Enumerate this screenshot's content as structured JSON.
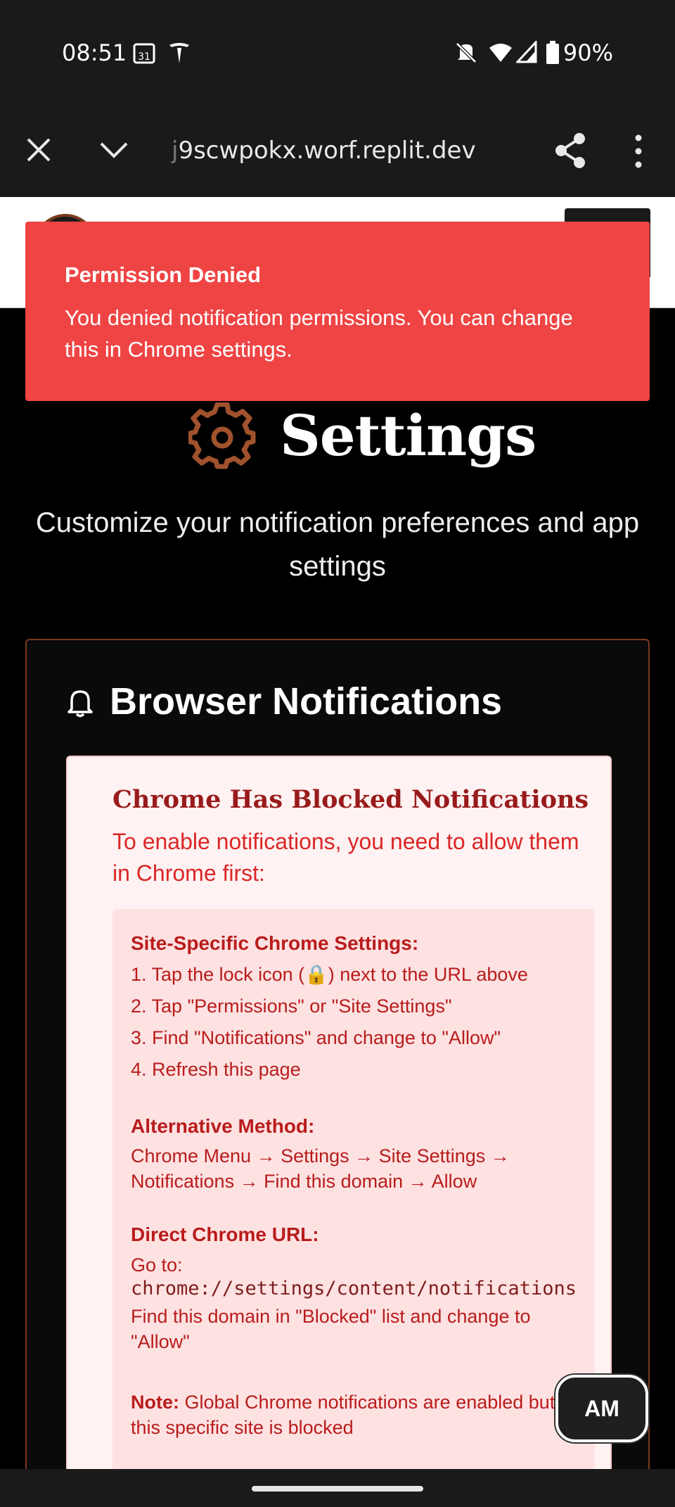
{
  "status_bar": {
    "time": "08:51",
    "battery": "90%",
    "icons": [
      "calendar-icon",
      "tesla-icon",
      "mute-icon",
      "wifi-icon",
      "signal-icon",
      "battery-icon"
    ]
  },
  "browser": {
    "url_prefix": "j",
    "url": "9scwpokx.worf.replit.dev"
  },
  "toast": {
    "title": "Permission Denied",
    "description": "You denied notification permissions. You can change this in Chrome settings.",
    "color": "#ef4444"
  },
  "page": {
    "title": "Settings",
    "subtitle": "Customize your notification preferences and app settings"
  },
  "card": {
    "title": "Browser Notifications",
    "blocked": {
      "title": "Chrome Has Blocked Notifications",
      "description": "To enable notifications, you need to allow them in Chrome first:",
      "site_specific": {
        "title": "Site-Specific Chrome Settings:",
        "step1_before": "1. Tap the lock icon (",
        "step1_lock": "🔒",
        "step1_after": ") next to the URL above",
        "step2": "2. Tap \"Permissions\" or \"Site Settings\"",
        "step3": "3. Find \"Notifications\" and change to \"Allow\"",
        "step4": "4. Refresh this page"
      },
      "alternative": {
        "title": "Alternative Method:",
        "text": "Chrome Menu → Settings → Site Settings → Notifications → Find this domain → Allow"
      },
      "direct": {
        "title": "Direct Chrome URL:",
        "go_to": "Go to:",
        "url": "chrome://settings/content/notifications",
        "text": "Find this domain in \"Blocked\" list and change to \"Allow\""
      },
      "note": {
        "label": "Note:",
        "text": " Global Chrome notifications are enabled but this specific site is blocked"
      }
    }
  },
  "fab": {
    "label": "AM"
  }
}
